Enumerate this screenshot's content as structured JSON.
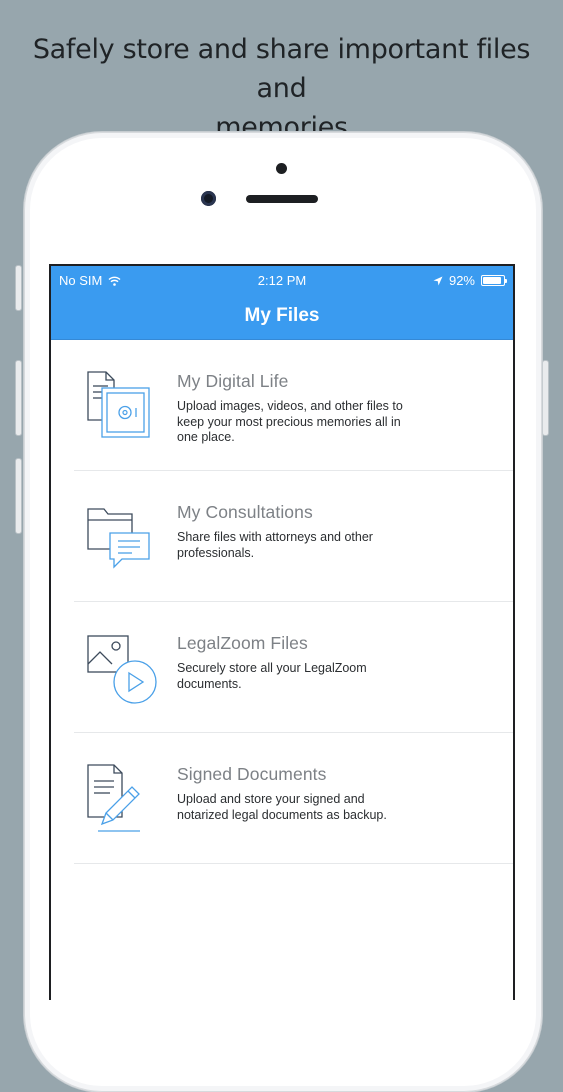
{
  "headline": {
    "line1": "Safely store and share important files and",
    "line2": "memories"
  },
  "status_bar": {
    "carrier": "No SIM",
    "time": "2:12 PM",
    "battery": "92%",
    "battery_level": 0.92,
    "icons": [
      "wifi-icon",
      "location-arrow-icon",
      "battery-icon"
    ]
  },
  "nav": {
    "title": "My Files"
  },
  "items": [
    {
      "title": "My Digital Life",
      "desc_line1": "Upload images, videos, and other files to",
      "desc_line2": "keep your most precious memories all in",
      "desc_line3": "one place.",
      "icon": "vault-documents-icon"
    },
    {
      "title": "My Consultations",
      "desc_line1": "Share files with attorneys and other",
      "desc_line2": "professionals.",
      "icon": "folder-chat-icon"
    },
    {
      "title": "LegalZoom Files",
      "desc_line1": "Securely store all your LegalZoom",
      "desc_line2": "documents.",
      "icon": "image-play-icon"
    },
    {
      "title": "Signed Documents",
      "desc_line1": "Upload and store your signed and",
      "desc_line2": "notarized legal documents as backup.",
      "icon": "document-pen-icon"
    }
  ],
  "colors": {
    "accent": "#3a9bf0",
    "icon_stroke": "#4aa0e8",
    "icon_dark": "#3d4b5c",
    "background": "#97a6ad"
  }
}
